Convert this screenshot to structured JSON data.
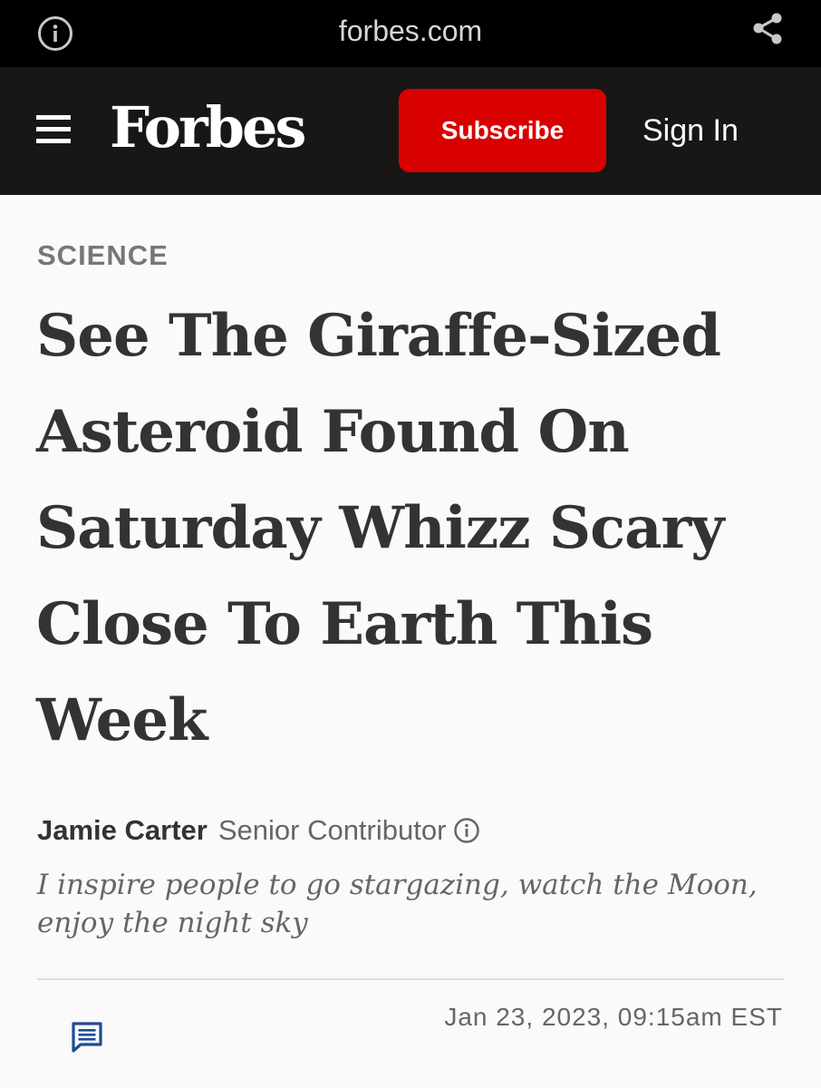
{
  "browser": {
    "url": "forbes.com",
    "info_icon": "info-icon",
    "share_icon": "share-icon"
  },
  "header": {
    "menu_icon": "hamburger-menu-icon",
    "logo": "Forbes",
    "subscribe_label": "Subscribe",
    "signin_label": "Sign In",
    "colors": {
      "header_bg": "#181716",
      "subscribe_bg": "#d90000"
    }
  },
  "article": {
    "section": "SCIENCE",
    "headline": "See The Giraffe-Sized Asteroid Found On Saturday Whizz Scary Close To Earth This Week",
    "author": {
      "name": "Jamie Carter",
      "role": "Senior Contributor",
      "info_icon": "info-icon",
      "bio": "I inspire people to go stargazing, watch the Moon, enjoy the night sky"
    },
    "comment_icon": "comment-icon",
    "date": "Jan 23, 2023,  09:15am EST"
  }
}
